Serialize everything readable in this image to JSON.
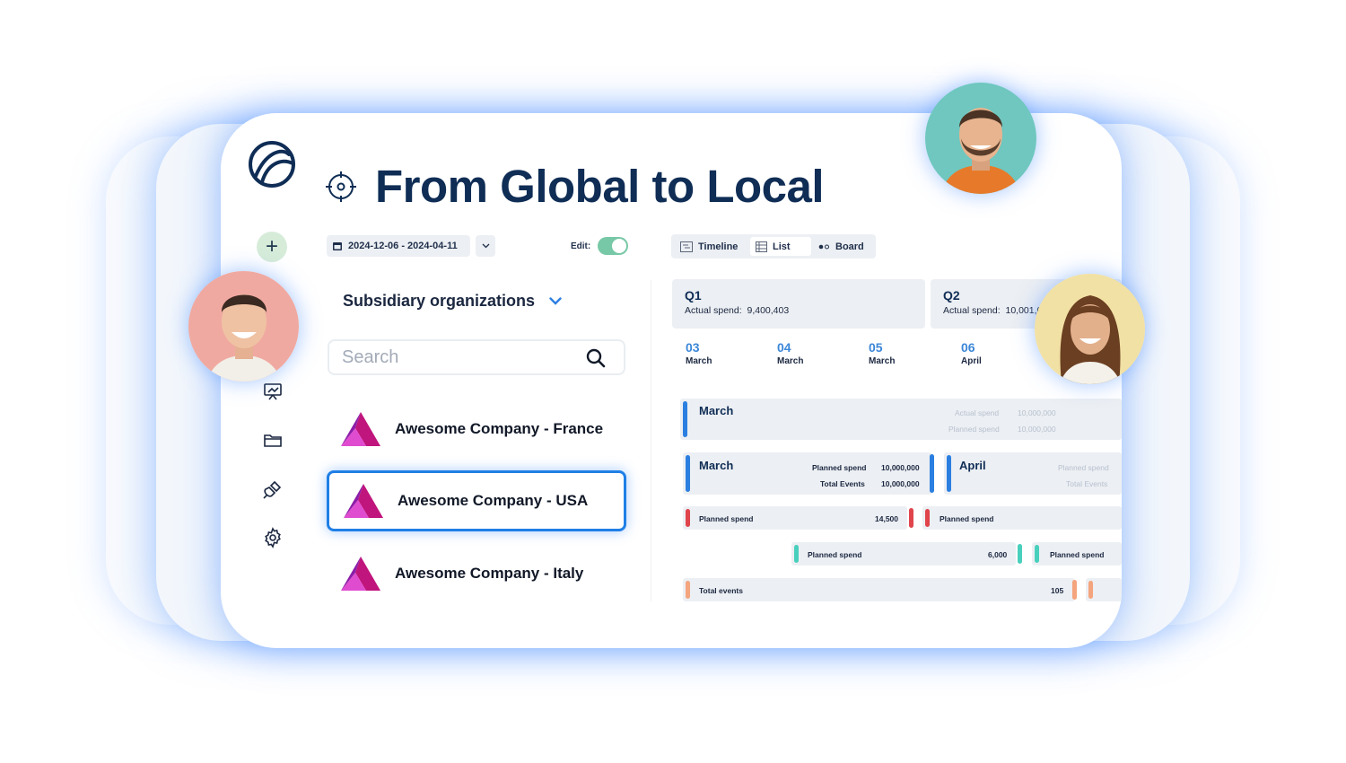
{
  "header": {
    "title": "From Global to Local"
  },
  "toolbar": {
    "date_range": "2024-12-06 - 2024-04-11",
    "edit_label": "Edit:",
    "edit_enabled": true,
    "views": [
      {
        "label": "Timeline",
        "icon": "timeline-icon",
        "active": false
      },
      {
        "label": "List",
        "icon": "list-icon",
        "active": true
      },
      {
        "label": "Board",
        "icon": "board-icon",
        "active": false
      }
    ]
  },
  "sidebar": {
    "items": [
      {
        "icon": "plus-icon"
      },
      {
        "icon": "presentation-icon"
      },
      {
        "icon": "folder-icon"
      },
      {
        "icon": "plug-icon"
      },
      {
        "icon": "gear-icon"
      }
    ]
  },
  "subsidiaries": {
    "heading": "Subsidiary organizations",
    "search_placeholder": "Search",
    "items": [
      {
        "name": "Awesome Company - France",
        "selected": false
      },
      {
        "name": "Awesome Company - USA",
        "selected": true
      },
      {
        "name": "Awesome Company - Italy",
        "selected": false
      }
    ]
  },
  "quarters": [
    {
      "label": "Q1",
      "spend_label": "Actual spend:",
      "spend_value": "9,400,403"
    },
    {
      "label": "Q2",
      "spend_label": "Actual spend:",
      "spend_value": "10,001,0"
    }
  ],
  "weeks": [
    {
      "number": "03",
      "month": "March"
    },
    {
      "number": "04",
      "month": "March"
    },
    {
      "number": "05",
      "month": "March"
    },
    {
      "number": "06",
      "month": "April"
    }
  ],
  "timeline": {
    "row1": {
      "title": "March",
      "actual_label": "Actual spend",
      "actual_value": "10,000,000",
      "planned_label": "Planned spend",
      "planned_value": "10,000,000"
    },
    "row2a": {
      "title": "March",
      "planned_label": "Planned spend",
      "planned_value": "10,000,000",
      "events_label": "Total Events",
      "events_value": "10,000,000"
    },
    "row2b": {
      "title": "April",
      "planned_label": "Planned spend",
      "events_label": "Total Events"
    },
    "row3a": {
      "label": "Planned spend",
      "value": "14,500"
    },
    "row3b": {
      "label": "Planned spend"
    },
    "row4a": {
      "label": "Planned spend",
      "value": "6,000"
    },
    "row4b": {
      "label": "Planned spend"
    },
    "row5": {
      "label": "Total events",
      "value": "105"
    }
  },
  "colors": {
    "brand": "#0f2d55",
    "accent_blue": "#1f7fe6",
    "accent_red": "#e0454c",
    "accent_teal": "#49d0bd",
    "accent_orange": "#f4a57e",
    "toggle_on": "#77c8a6"
  }
}
